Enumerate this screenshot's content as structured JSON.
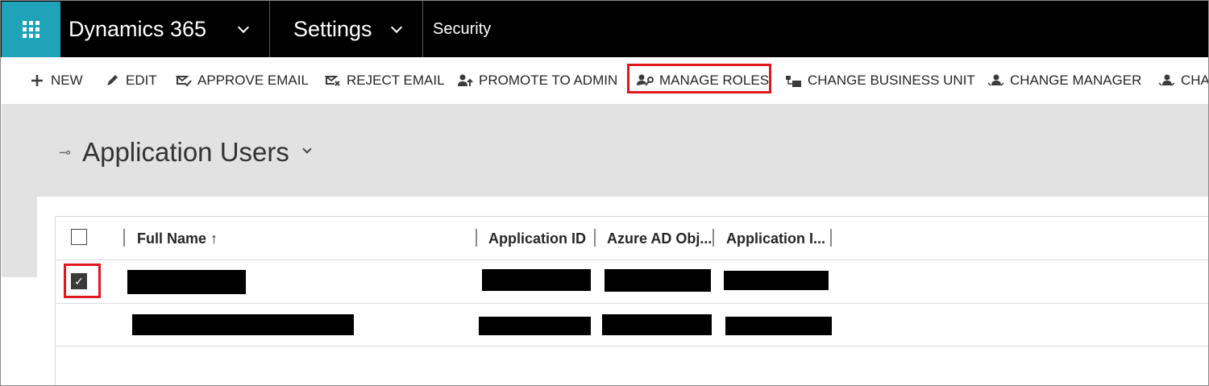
{
  "nav": {
    "app_title": "Dynamics 365",
    "area": "Settings",
    "page": "Security"
  },
  "commands": [
    {
      "label": "NEW",
      "icon": "plus-icon"
    },
    {
      "label": "EDIT",
      "icon": "pencil-icon"
    },
    {
      "label": "APPROVE EMAIL",
      "icon": "approve-email-icon"
    },
    {
      "label": "REJECT EMAIL",
      "icon": "reject-email-icon"
    },
    {
      "label": "PROMOTE TO ADMIN",
      "icon": "promote-admin-icon"
    },
    {
      "label": "MANAGE ROLES",
      "icon": "manage-roles-icon"
    },
    {
      "label": "CHANGE BUSINESS UNIT",
      "icon": "business-unit-icon"
    },
    {
      "label": "CHANGE MANAGER",
      "icon": "change-manager-icon"
    },
    {
      "label": "CHA",
      "icon": "change-icon"
    }
  ],
  "view": {
    "title": "Application Users"
  },
  "grid": {
    "columns": [
      {
        "label": "Full Name ↑"
      },
      {
        "label": "Application ID"
      },
      {
        "label": "Azure AD Obj..."
      },
      {
        "label": "Application I..."
      }
    ],
    "rows": [
      {
        "selected": true
      },
      {
        "selected": false
      }
    ]
  },
  "colors": {
    "nav_bg": "#000000",
    "waffle_bg": "#1ea3b8",
    "highlight": "#e0171f",
    "workspace_bg": "#e2e2e2"
  }
}
